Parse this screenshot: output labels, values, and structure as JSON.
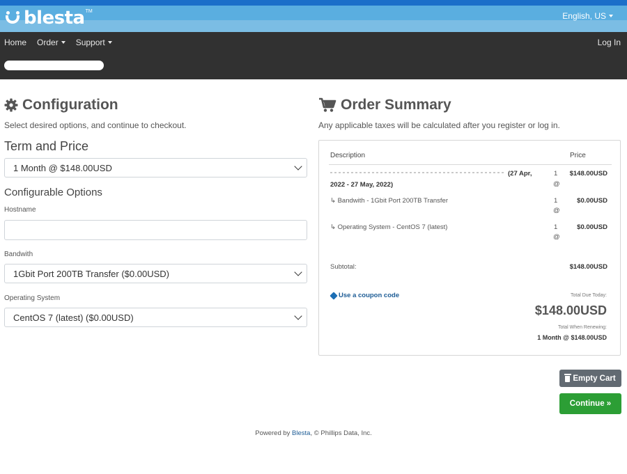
{
  "header": {
    "logo_text": "blesta",
    "logo_tm": "TM",
    "language": "English, US"
  },
  "nav": {
    "items": [
      {
        "label": "Home",
        "has_dropdown": false
      },
      {
        "label": "Order",
        "has_dropdown": true
      },
      {
        "label": "Support",
        "has_dropdown": true
      }
    ],
    "login": "Log In"
  },
  "config": {
    "title": "Configuration",
    "subtitle": "Select desired options, and continue to checkout.",
    "term_heading": "Term and Price",
    "term_selected": "1 Month @ $148.00USD",
    "options_heading": "Configurable Options",
    "hostname_label": "Hostname",
    "hostname_value": "",
    "bandwidth_label": "Bandwith",
    "bandwidth_selected": "1Gbit Port 200TB Transfer ($0.00USD)",
    "os_label": "Operating System",
    "os_selected": "CentOS 7 (latest) ($0.00USD)"
  },
  "summary": {
    "title": "Order Summary",
    "subtitle": "Any applicable taxes will be calculated after you register or log in.",
    "col_description": "Description",
    "col_price": "Price",
    "rows": [
      {
        "desc_tail": "(27 Apr,",
        "desc_line2": "2022 - 27 May, 2022)",
        "qty": "1",
        "qty_sym": "@",
        "price": "$148.00USD"
      },
      {
        "desc": "↳ Bandwith - 1Gbit Port 200TB Transfer",
        "qty": "1",
        "qty_sym": "@",
        "price": "$0.00USD"
      },
      {
        "desc": "↳ Operating System - CentOS 7 (latest)",
        "qty": "1",
        "qty_sym": "@",
        "price": "$0.00USD"
      }
    ],
    "subtotal_label": "Subtotal:",
    "subtotal_value": "$148.00USD",
    "coupon_link": "Use a coupon code",
    "total_due_label": "Total Due Today:",
    "total_due_value": "$148.00USD",
    "renew_label": "Total When Renewing:",
    "renew_value": "1 Month @ $148.00USD"
  },
  "actions": {
    "empty_cart": "Empty Cart",
    "continue": "Continue »"
  },
  "footer": {
    "prefix": "Powered by ",
    "link": "Blesta",
    "suffix": ", © Phillips Data, Inc."
  },
  "colors": {
    "brand_blue": "#5aaee0",
    "nav_dark": "#313131",
    "continue_green": "#2c9e35",
    "empty_gray": "#626a72",
    "link_blue": "#1d5c95"
  }
}
